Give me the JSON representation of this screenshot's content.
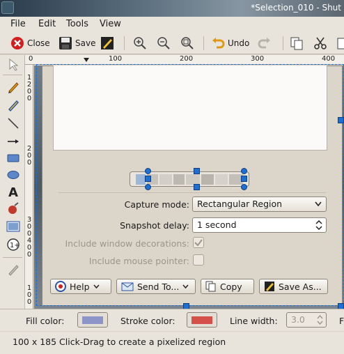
{
  "window": {
    "title": "*Selection_010 - Shut"
  },
  "menu": {
    "file": "File",
    "edit": "Edit",
    "tools": "Tools",
    "view": "View"
  },
  "toolbar": {
    "close_label": "Close",
    "save_label": "Save",
    "undo_label": "Undo"
  },
  "ruler": {
    "ticks": [
      "0",
      "100",
      "200",
      "300",
      "400"
    ],
    "vticks": [
      "1",
      "2",
      "0",
      "0",
      "1",
      "2",
      "0",
      "0",
      "3",
      "0",
      "0",
      "4",
      "0",
      "0",
      "1",
      "0",
      "0"
    ]
  },
  "dialog": {
    "capture_mode_label": "Capture mode:",
    "capture_mode_value": "Rectangular Region",
    "snapshot_delay_label": "Snapshot delay:",
    "snapshot_delay_value": "1 second",
    "include_window_decorations": "Include window decorations:",
    "include_mouse_pointer": "Include mouse pointer:",
    "buttons": {
      "help": "Help",
      "send_to": "Send To...",
      "copy": "Copy",
      "save_as": "Save As..."
    }
  },
  "properties": {
    "fill_color_label": "Fill color:",
    "fill_color": "#8c94c8",
    "stroke_color_label": "Stroke color:",
    "stroke_color": "#d6504a",
    "line_width_label": "Line width:",
    "line_width_value": "3.0",
    "font_label": "F"
  },
  "status": {
    "text": "100 x 185 Click-Drag to create a pixelized region"
  },
  "colors": {
    "accent": "#1e6fd0",
    "panel": "#e8e4dc"
  }
}
